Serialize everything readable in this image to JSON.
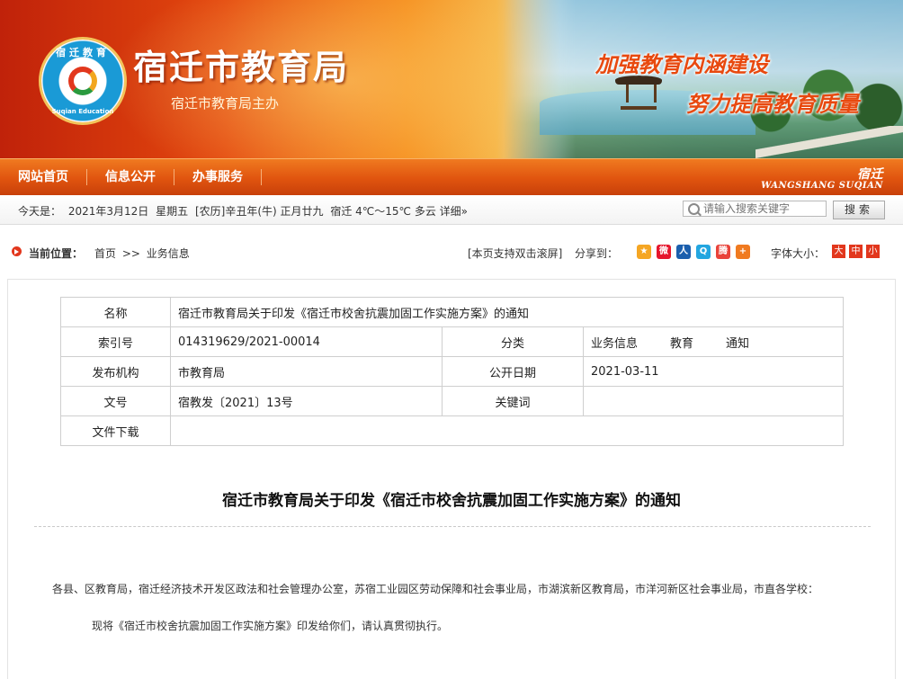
{
  "banner": {
    "logo_top": "宿迁教育",
    "logo_bottom": "Suqian Education",
    "title": "宿迁市教育局",
    "subtitle": "宿迁市教育局主办",
    "slogan1": "加强教育内涵建设",
    "slogan2": "努力提高教育质量"
  },
  "nav": {
    "items": [
      "网站首页",
      "信息公开",
      "办事服务"
    ],
    "brand_cn": "宿迁",
    "brand_en": "WANGSHANG SUQIAN"
  },
  "infobar": {
    "today_label": "今天是：",
    "date": "2021年3月12日",
    "weekday": "星期五",
    "lunar": "[农历]辛丑年(牛) 正月廿九",
    "weather": "宿迁 4℃～15℃ 多云 详细»",
    "search_placeholder": "请输入搜索关键字",
    "search_button": "搜索"
  },
  "location": {
    "label": "当前位置：",
    "crumbs": [
      "首页",
      "业务信息"
    ],
    "crumb_sep": ">>",
    "dblclick_hint": "[本页支持双击滚屏]",
    "share_label": "分享到：",
    "share_icons": [
      {
        "name": "qzone-icon",
        "glyph": "★",
        "color": "#f5a623"
      },
      {
        "name": "weibo-icon",
        "glyph": "微",
        "color": "#e6162d"
      },
      {
        "name": "renren-icon",
        "glyph": "人",
        "color": "#1b5fad"
      },
      {
        "name": "qq-icon",
        "glyph": "Q",
        "color": "#23a6e0"
      },
      {
        "name": "tencent-weibo-icon",
        "glyph": "腾",
        "color": "#e9433a"
      },
      {
        "name": "more-share-icon",
        "glyph": "+",
        "color": "#f07a20"
      }
    ],
    "font_label": "字体大小：",
    "font_sizes": [
      "大",
      "中",
      "小"
    ]
  },
  "meta": {
    "name_label": "名称",
    "name_value": "宿迁市教育局关于印发《宿迁市校舍抗震加固工作实施方案》的通知",
    "index_label": "索引号",
    "index_value": "014319629/2021-00014",
    "category_label": "分类",
    "category_values": [
      "业务信息",
      "教育",
      "通知"
    ],
    "org_label": "发布机构",
    "org_value": "市教育局",
    "date_label": "公开日期",
    "date_value": "2021-03-11",
    "docno_label": "文号",
    "docno_value": "宿教发〔2021〕13号",
    "keyword_label": "关键词",
    "keyword_value": "",
    "download_label": "文件下载",
    "download_value": ""
  },
  "article": {
    "title": "宿迁市教育局关于印发《宿迁市校舍抗震加固工作实施方案》的通知",
    "p1": "各县、区教育局，宿迁经济技术开发区政法和社会管理办公室，苏宿工业园区劳动保障和社会事业局，市湖滨新区教育局，市洋河新区社会事业局，市直各学校：",
    "p2": "现将《宿迁市校舍抗震加固工作实施方案》印发给你们，请认真贯彻执行。"
  }
}
